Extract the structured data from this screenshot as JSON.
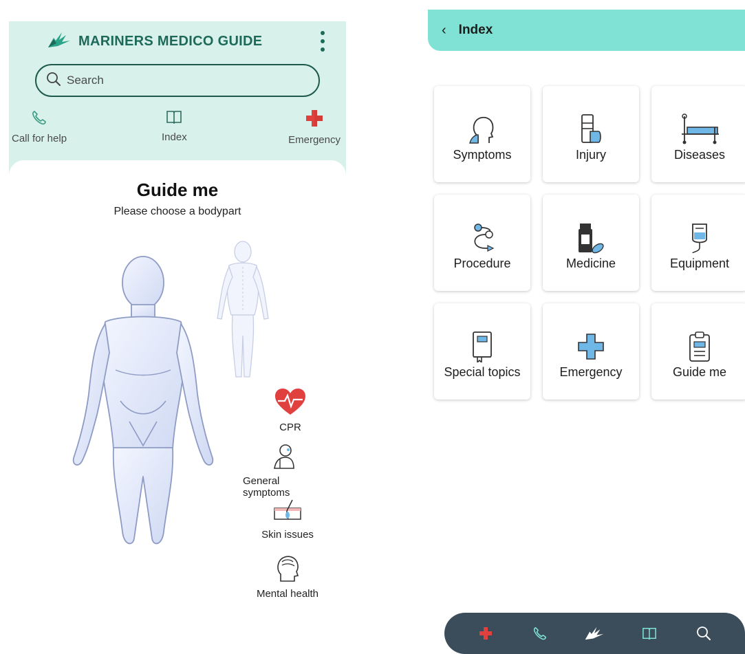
{
  "left": {
    "app_title": "MARINERS MEDICO GUIDE",
    "search": {
      "placeholder": "Search",
      "value": ""
    },
    "quick_actions": {
      "call": "Call for help",
      "index": "Index",
      "emergency": "Emergency"
    },
    "guide": {
      "title": "Guide me",
      "subtitle": "Please choose a bodypart"
    },
    "shortcuts": {
      "cpr": "CPR",
      "general": "General symptoms",
      "skin": "Skin issues",
      "mental": "Mental health"
    }
  },
  "right": {
    "header": {
      "back_icon": "chevron-left-icon",
      "title": "Index"
    },
    "tiles": [
      {
        "label": "Symptoms",
        "icon": "head-symptoms-icon"
      },
      {
        "label": "Injury",
        "icon": "bandaged-arm-icon"
      },
      {
        "label": "Diseases",
        "icon": "hospital-bed-icon"
      },
      {
        "label": "Procedure",
        "icon": "procedure-flow-icon"
      },
      {
        "label": "Medicine",
        "icon": "medicine-bottle-icon"
      },
      {
        "label": "Equipment",
        "icon": "iv-bag-icon"
      },
      {
        "label": "Special topics",
        "icon": "book-icon"
      },
      {
        "label": "Emergency",
        "icon": "medical-cross-icon"
      },
      {
        "label": "Guide me",
        "icon": "clipboard-icon"
      }
    ],
    "bottom_nav": [
      "emergency-cross-icon",
      "phone-icon",
      "swallow-logo-icon",
      "book-icon",
      "search-icon"
    ]
  },
  "colors": {
    "header_bg": "#d8f1ea",
    "brand_green": "#1e6a5a",
    "right_header": "#7fe2d4",
    "accent_blue": "#6fb7e6",
    "emergency_red": "#e0413f",
    "bottom_bar": "#3b4d5a"
  }
}
